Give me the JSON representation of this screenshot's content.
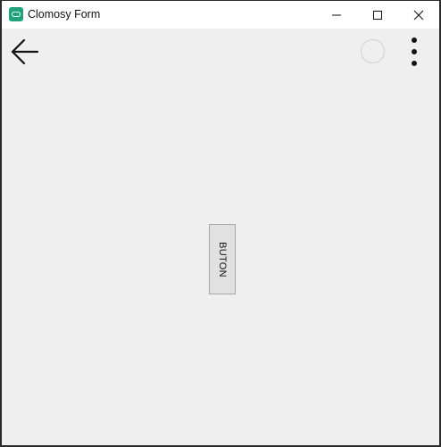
{
  "window": {
    "title": "Clomosy Form",
    "icon": "clomosy-app-icon",
    "controls": {
      "minimize_icon": "minimize-icon",
      "maximize_icon": "maximize-icon",
      "close_icon": "close-icon"
    }
  },
  "toolbar": {
    "back_icon": "arrow-left-icon",
    "status_icon": "circle-icon",
    "more_icon": "more-vertical-icon"
  },
  "content": {
    "button_label": "BUTON"
  },
  "colors": {
    "app_icon": "#1fa37a",
    "background": "#efefef",
    "titlebar": "#ffffff"
  }
}
